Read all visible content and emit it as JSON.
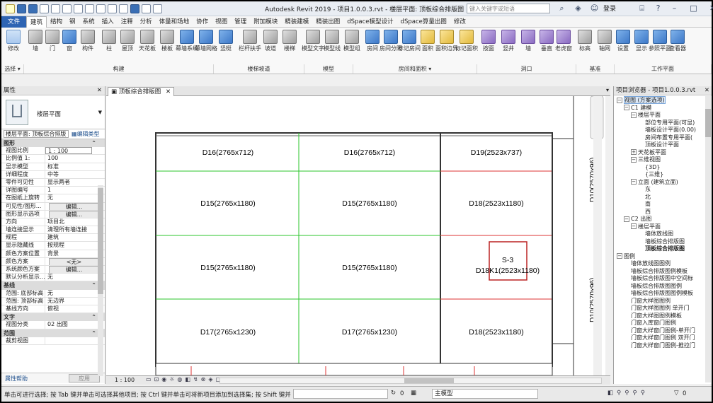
{
  "app": {
    "title": "Autodesk Revit 2019 - 项目1.0.0.3.rvt - 楼层平面: 顶板综合排版图",
    "search_placeholder": "键入关键字或短语",
    "user": "登录"
  },
  "menu": {
    "tabs": [
      "文件",
      "建筑",
      "结构",
      "钢",
      "系统",
      "插入",
      "注释",
      "分析",
      "体量和场地",
      "协作",
      "视图",
      "管理",
      "附加模块",
      "精装建模",
      "精装出图",
      "dSpace模型设计",
      "dSpace算量出图",
      "修改"
    ],
    "active": "建筑"
  },
  "ribbon": {
    "buttons": [
      {
        "label": "修改",
        "icon": "cursor-icon",
        "color": "sel"
      },
      {
        "label": "墙",
        "icon": "wall-icon",
        "color": "grey"
      },
      {
        "label": "门",
        "icon": "door-icon",
        "color": "grey"
      },
      {
        "label": "窗",
        "icon": "window-icon",
        "color": "blue"
      },
      {
        "label": "构件",
        "icon": "component-icon",
        "color": "grey"
      },
      {
        "label": "柱",
        "icon": "column-icon",
        "color": "grey"
      },
      {
        "label": "屋顶",
        "icon": "roof-icon",
        "color": "grey"
      },
      {
        "label": "天花板",
        "icon": "ceiling-icon",
        "color": "grey"
      },
      {
        "label": "楼板",
        "icon": "floor-icon",
        "color": "grey"
      },
      {
        "label": "幕墙系统",
        "icon": "curtain-system-icon",
        "color": "blue"
      },
      {
        "label": "幕墙网格",
        "icon": "curtain-grid-icon",
        "color": "blue"
      },
      {
        "label": "竖梃",
        "icon": "mullion-icon",
        "color": "blue"
      },
      {
        "label": "栏杆扶手",
        "icon": "railing-icon",
        "color": "grey"
      },
      {
        "label": "坡道",
        "icon": "ramp-icon",
        "color": "grey"
      },
      {
        "label": "楼梯",
        "icon": "stair-icon",
        "color": "grey"
      },
      {
        "label": "模型文字",
        "icon": "model-text-icon",
        "color": "grey"
      },
      {
        "label": "模型线",
        "icon": "model-line-icon",
        "color": "grey"
      },
      {
        "label": "模型组",
        "icon": "model-group-icon",
        "color": "grey"
      },
      {
        "label": "房间",
        "icon": "room-icon",
        "color": "blue"
      },
      {
        "label": "房间分隔",
        "icon": "room-separator-icon",
        "color": "blue"
      },
      {
        "label": "标记房间",
        "icon": "tag-room-icon",
        "color": "blue"
      },
      {
        "label": "面积",
        "icon": "area-icon",
        "color": "yellow"
      },
      {
        "label": "面积边界",
        "icon": "area-boundary-icon",
        "color": "yellow"
      },
      {
        "label": "标记面积",
        "icon": "tag-area-icon",
        "color": "yellow"
      },
      {
        "label": "按面",
        "icon": "by-face-icon",
        "color": "purple"
      },
      {
        "label": "竖井",
        "icon": "shaft-icon",
        "color": "purple"
      },
      {
        "label": "墙",
        "icon": "wall-opening-icon",
        "color": "purple"
      },
      {
        "label": "垂直",
        "icon": "vertical-opening-icon",
        "color": "purple"
      },
      {
        "label": "老虎窗",
        "icon": "dormer-icon",
        "color": "purple"
      },
      {
        "label": "标高",
        "icon": "level-icon",
        "color": "grey"
      },
      {
        "label": "轴网",
        "icon": "grid-icon",
        "color": "grey"
      },
      {
        "label": "设置",
        "icon": "set-workplane-icon",
        "color": "blue"
      },
      {
        "label": "显示",
        "icon": "show-workplane-icon",
        "color": "blue"
      },
      {
        "label": "参照平面",
        "icon": "ref-plane-icon",
        "color": "blue"
      },
      {
        "label": "查看器",
        "icon": "viewer-icon",
        "color": "blue"
      }
    ],
    "panels": [
      "选择 ▾",
      "构建",
      "楼梯坡道",
      "模型",
      "房间和面积 ▾",
      "洞口",
      "基准",
      "工作平面"
    ]
  },
  "properties": {
    "header": "属性",
    "type_name": "楼层平面",
    "selector": "楼层平面: 顶板综合排版",
    "edit_type": "编辑类型",
    "groups": [
      {
        "name": "图形",
        "rows": [
          [
            "视图比例",
            "1 : 100"
          ],
          [
            "比例值 1:",
            "100"
          ],
          [
            "显示模型",
            "标准"
          ],
          [
            "详细程度",
            "中等"
          ],
          [
            "零件可见性",
            "显示两者"
          ],
          [
            "详图编号",
            "1"
          ],
          [
            "在图纸上旋转",
            "无"
          ],
          [
            "可见性/图形...",
            "编辑..."
          ],
          [
            "图形显示选项",
            "编辑..."
          ],
          [
            "方向",
            "项目北"
          ],
          [
            "墙连接显示",
            "清理所有墙连接"
          ],
          [
            "规程",
            "建筑"
          ],
          [
            "显示隐藏线",
            "按规程"
          ],
          [
            "颜色方案位置",
            "背景"
          ],
          [
            "颜色方案",
            "<无>"
          ],
          [
            "系统颜色方案",
            "编辑..."
          ],
          [
            "默认分析显示...",
            "无"
          ]
        ]
      },
      {
        "name": "基线",
        "rows": [
          [
            "范围: 底部标高",
            "无"
          ],
          [
            "范围: 顶部标高",
            "无边界"
          ],
          [
            "基线方向",
            "俯视"
          ]
        ]
      },
      {
        "name": "文字",
        "rows": [
          [
            "视图分类",
            "02 出图"
          ]
        ]
      },
      {
        "name": "范围",
        "rows": [
          [
            "裁剪视图",
            ""
          ]
        ]
      }
    ],
    "help": "属性帮助",
    "apply": "应用"
  },
  "document": {
    "tab": "顶板综合排版图",
    "scale": "1 : 100"
  },
  "canvas": {
    "cells": [
      {
        "id": "d16a",
        "label": "D16(2765x712)"
      },
      {
        "id": "d16b",
        "label": "D16(2765x712)"
      },
      {
        "id": "d19",
        "label": "D19(2523x737)"
      },
      {
        "id": "d15a",
        "label": "D15(2765x1180)"
      },
      {
        "id": "d15b",
        "label": "D15(2765x1180)"
      },
      {
        "id": "d18a",
        "label": "D18(2523x1180)"
      },
      {
        "id": "d15c",
        "label": "D15(2765x1180)"
      },
      {
        "id": "d15d",
        "label": "D15(2765x1180)"
      },
      {
        "id": "d18k1",
        "label": "D18K1(2523x1180)"
      },
      {
        "id": "d17a",
        "label": "D17(2765x1230)"
      },
      {
        "id": "d17b",
        "label": "D17(2765x1230)"
      },
      {
        "id": "d18b",
        "label": "D18(2523x1180)"
      }
    ],
    "marker": "S-3",
    "side_labels": [
      "D10(2570x96)",
      "D10(2570x96)"
    ]
  },
  "browser": {
    "header": "项目浏览器 - 项目1.0.0.3.rvt",
    "tree": [
      {
        "d": 0,
        "t": "视图 (方案选项)",
        "tg": "−",
        "sel": true
      },
      {
        "d": 1,
        "t": "C1 建模",
        "tg": "−"
      },
      {
        "d": 2,
        "t": "楼层平面",
        "tg": "−"
      },
      {
        "d": 3,
        "t": "部位专用平面(可显)"
      },
      {
        "d": 3,
        "t": "墙板设计平面(0.00)"
      },
      {
        "d": 3,
        "t": "房间布置专用平面("
      },
      {
        "d": 3,
        "t": "顶板设计平面"
      },
      {
        "d": 2,
        "t": "天花板平面",
        "tg": "+"
      },
      {
        "d": 2,
        "t": "三维视图",
        "tg": "−"
      },
      {
        "d": 3,
        "t": "{3D}"
      },
      {
        "d": 3,
        "t": "{三维}"
      },
      {
        "d": 2,
        "t": "立面 (建筑立面)",
        "tg": "−"
      },
      {
        "d": 3,
        "t": "东"
      },
      {
        "d": 3,
        "t": "北"
      },
      {
        "d": 3,
        "t": "南"
      },
      {
        "d": 3,
        "t": "西"
      },
      {
        "d": 1,
        "t": "C2 出图",
        "tg": "−"
      },
      {
        "d": 2,
        "t": "楼层平面",
        "tg": "−"
      },
      {
        "d": 3,
        "t": "墙体放线图"
      },
      {
        "d": 3,
        "t": "墙板综合排版图"
      },
      {
        "d": 3,
        "t": "顶板综合排版图",
        "bold": true
      },
      {
        "d": 0,
        "t": "图例",
        "tg": "−"
      },
      {
        "d": 1,
        "t": "墙体放线图图例"
      },
      {
        "d": 1,
        "t": "墙板综合排版图例模板"
      },
      {
        "d": 1,
        "t": "墙板综合排版图中空间标"
      },
      {
        "d": 1,
        "t": "墙板综合排版图图例"
      },
      {
        "d": 1,
        "t": "墙板综合排版图图例模板"
      },
      {
        "d": 1,
        "t": "门窗大样图图例"
      },
      {
        "d": 1,
        "t": "门窗大样图图例 单开门"
      },
      {
        "d": 1,
        "t": "门窗大样图图例模板"
      },
      {
        "d": 1,
        "t": "门窗入库窗门图例"
      },
      {
        "d": 1,
        "t": "门窗大样窗门图例-单开门"
      },
      {
        "d": 1,
        "t": "门窗大样窗门图例 双开门"
      },
      {
        "d": 1,
        "t": "门窗大样窗门图例-推拉门"
      }
    ]
  },
  "status": {
    "hint": "单击可进行选择; 按 Tab 键并单击可选择其他项目; 按 Ctrl 键并单击可将新项目添加到选择集; 按 Shift 键并单击可",
    "model": "主模型",
    "count": "0",
    "filter": "0"
  }
}
